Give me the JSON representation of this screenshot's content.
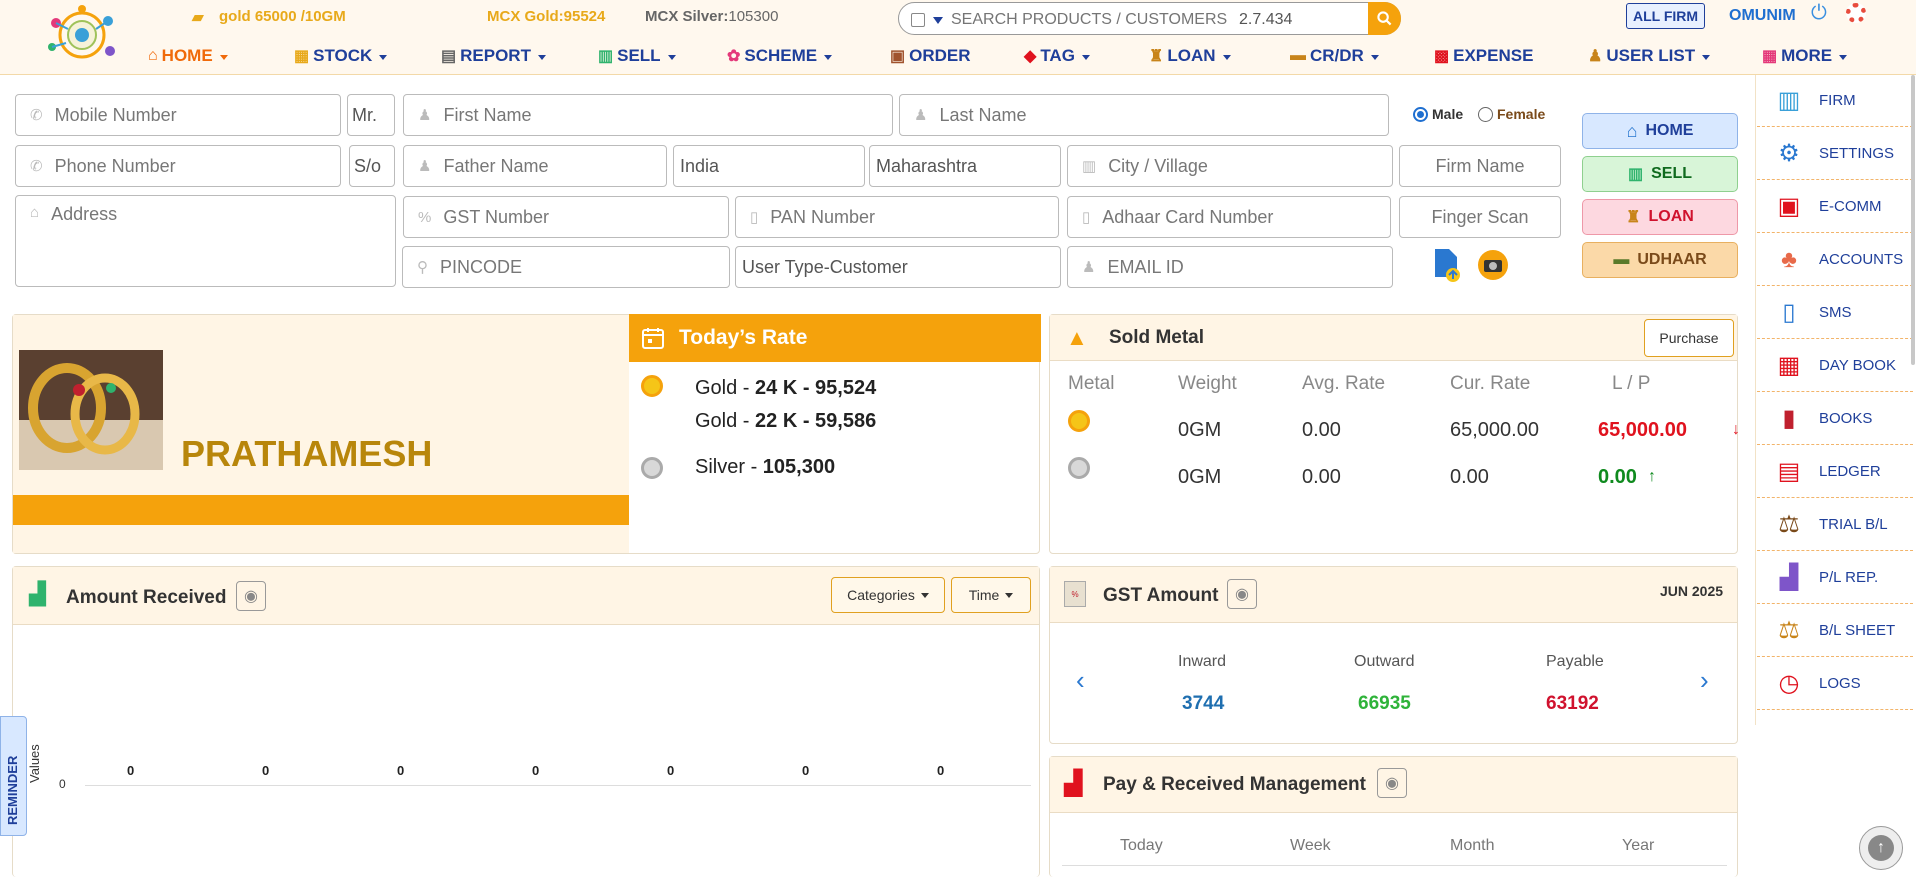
{
  "header": {
    "gold_ticker": "gold 65000 /10GM",
    "mcx_gold_label": "MCX Gold:",
    "mcx_gold_value": "95524",
    "mcx_silver_label": "MCX Silver:",
    "mcx_silver_value": "105300",
    "search_placeholder": "SEARCH PRODUCTS / CUSTOMERS ...",
    "version": "2.7.434",
    "all_firm": "ALL FIRM",
    "user": "OMUNIM"
  },
  "nav": [
    "HOME",
    "STOCK",
    "REPORT",
    "SELL",
    "SCHEME",
    "ORDER",
    "TAG",
    "LOAN",
    "CR/DR",
    "EXPENSE",
    "USER LIST",
    "MORE"
  ],
  "form": {
    "mobile_placeholder": "Mobile Number",
    "salutation": "Mr.",
    "first_name_placeholder": "First Name",
    "last_name_placeholder": "Last Name",
    "gender_male": "Male",
    "gender_female": "Female",
    "phone_placeholder": "Phone Number",
    "relation": "S/o",
    "father_name_placeholder": "Father Name",
    "country": "India",
    "state": "Maharashtra",
    "city_placeholder": "City / Village",
    "firm_name_placeholder": "Firm Name",
    "address_placeholder": "Address",
    "gst_placeholder": "GST Number",
    "pan_placeholder": "PAN Number",
    "adhaar_placeholder": "Adhaar Card Number",
    "finger_scan": "Finger Scan",
    "pincode_placeholder": "PINCODE",
    "user_type": "User Type-Customer",
    "email_placeholder": "EMAIL ID"
  },
  "side_buttons": {
    "home": "HOME",
    "sell": "SELL",
    "loan": "LOAN",
    "udhaar": "UDHAAR"
  },
  "right_sidebar": [
    "FIRM",
    "SETTINGS",
    "E-COMM",
    "ACCOUNTS",
    "SMS",
    "DAY BOOK",
    "BOOKS",
    "LEDGER",
    "TRIAL B/L",
    "P/L REP.",
    "B/L SHEET",
    "LOGS"
  ],
  "profile": {
    "name": "PRATHAMESH"
  },
  "todays_rate": {
    "title": "Today’s Rate",
    "gold_24_label": "Gold - ",
    "gold_24_value": "24 K - 95,524",
    "gold_22_label": "Gold - ",
    "gold_22_value": "22 K - 59,586",
    "silver_label": "Silver - ",
    "silver_value": "105,300"
  },
  "sold_metal": {
    "title": "Sold Metal",
    "purchase_button": "Purchase",
    "columns": [
      "Metal",
      "Weight",
      "Avg. Rate",
      "Cur. Rate",
      "L / P"
    ],
    "rows": [
      {
        "metal_icon": "gold-coin",
        "weight": "0GM",
        "avg_rate": "0.00",
        "cur_rate": "65,000.00",
        "lp": "65,000.00",
        "lp_color": "#e0121e",
        "trend": "down"
      },
      {
        "metal_icon": "silver-coin",
        "weight": "0GM",
        "avg_rate": "0.00",
        "cur_rate": "0.00",
        "lp": "0.00",
        "lp_color": "#0f8a1e",
        "trend": "up"
      }
    ]
  },
  "amount_received": {
    "title": "Amount Received",
    "categories_button": "Categories",
    "time_button": "Time",
    "ylabel": "Values",
    "y_tick": "0",
    "bar_labels": [
      "0",
      "0",
      "0",
      "0",
      "0",
      "0",
      "0"
    ]
  },
  "gst_amount": {
    "title": "GST Amount",
    "period": "JUN 2025",
    "inward_label": "Inward",
    "inward_value": "3744",
    "outward_label": "Outward",
    "outward_value": "66935",
    "payable_label": "Payable",
    "payable_value": "63192"
  },
  "pay_received": {
    "title": "Pay & Received Management",
    "columns": [
      "Today",
      "Week",
      "Month",
      "Year"
    ]
  },
  "reminder": "REMINDER",
  "colors": {
    "accent": "#f5a20c",
    "nav": "#1f3f9a",
    "brand_gold": "#b8860b"
  }
}
